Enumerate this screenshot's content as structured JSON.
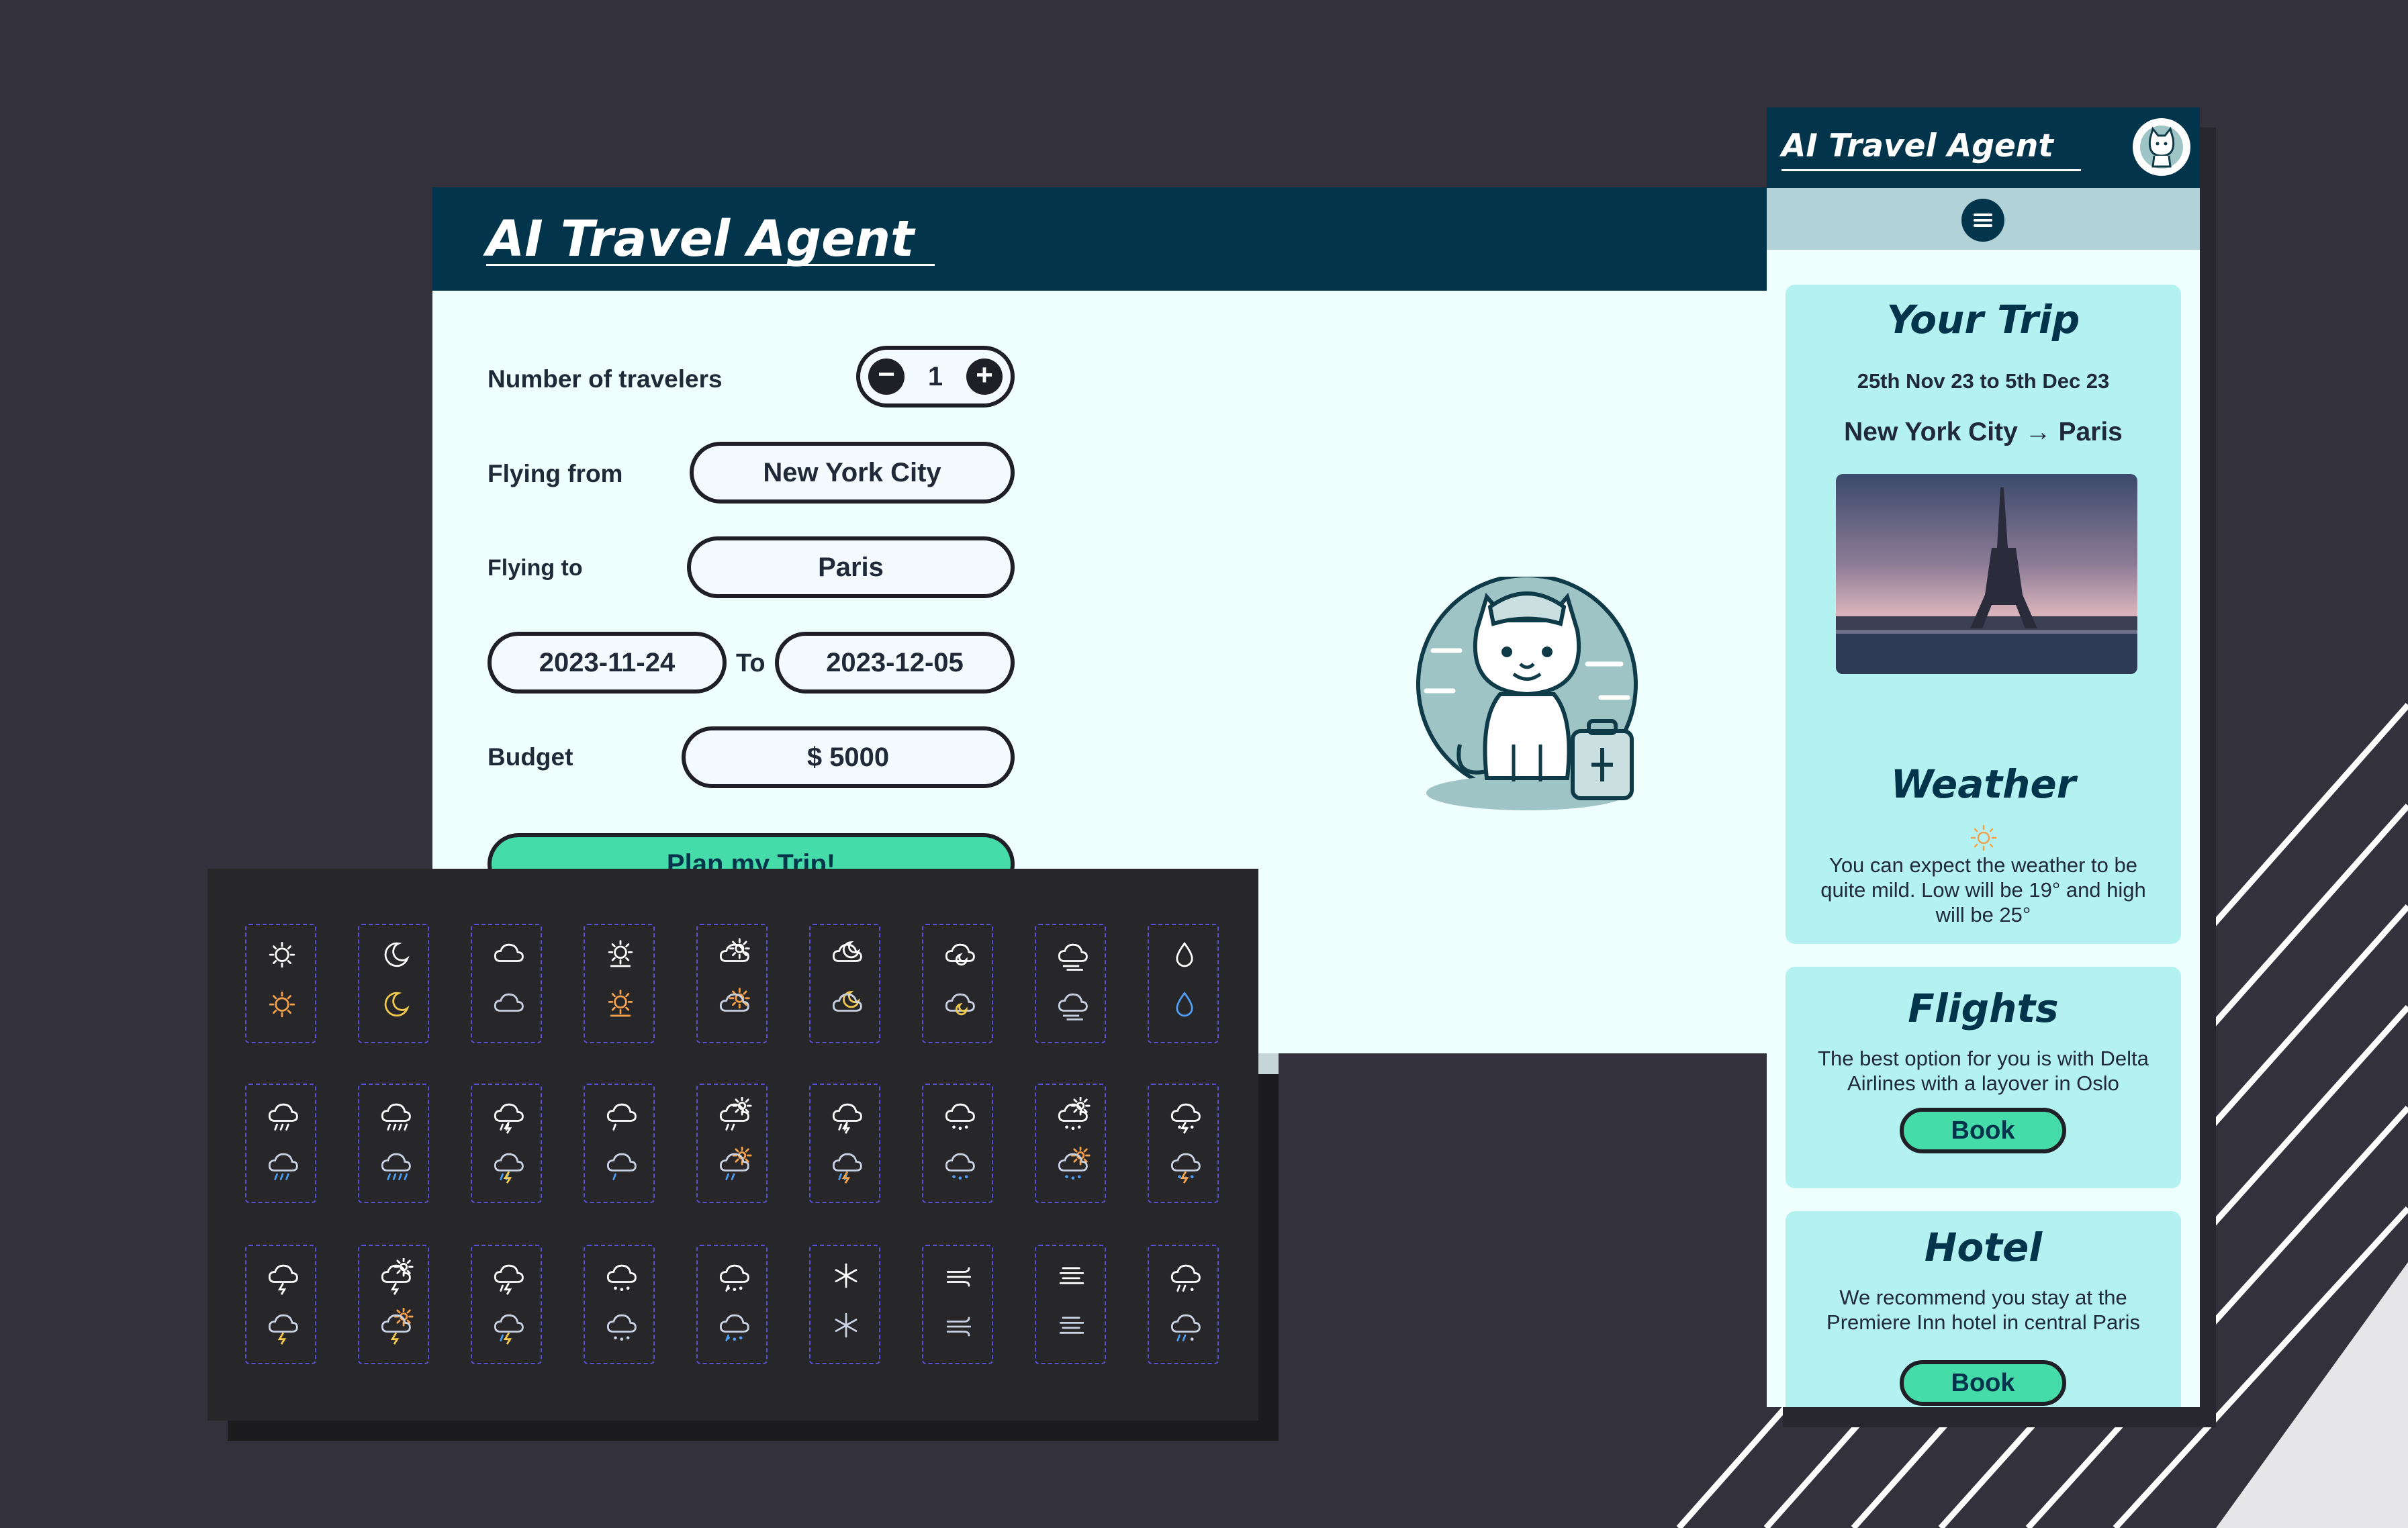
{
  "colors": {
    "background": "#33313b",
    "header": "#02344b",
    "panel": "#effffe",
    "card": "#b4f1f1",
    "accent": "#46dca9",
    "icon_dark_bg": "#27272a",
    "icon_border": "#5b4fd4"
  },
  "desktop": {
    "title": "AI Travel Agent",
    "travelers": {
      "label": "Number of travelers",
      "value": "1",
      "minus_icon": "minus-icon",
      "plus_icon": "plus-icon"
    },
    "from": {
      "label": "Flying from",
      "value": "New York City"
    },
    "to": {
      "label": "Flying to",
      "value": "Paris"
    },
    "dates": {
      "start": "2023-11-24",
      "separator": "To",
      "end": "2023-12-05"
    },
    "budget": {
      "label": "Budget",
      "value": "$ 5000"
    },
    "plan_button": "Plan my Trip!",
    "mascot_icon": "cat-pilot-mascot"
  },
  "mobile": {
    "title": "AI Travel Agent",
    "menu_icon": "hamburger-menu-icon",
    "trip": {
      "title": "Your Trip",
      "dates": "25th Nov 23 to 5th Dec 23",
      "route": "New York City → Paris",
      "image": "eiffel-tower-photo"
    },
    "weather": {
      "title": "Weather",
      "icon": "sun-icon",
      "text": "You can expect the weather to be quite mild. Low will be 19° and high will be 25°"
    },
    "flights": {
      "title": "Flights",
      "text": "The best option for you is with Delta Airlines with a layover in Oslo",
      "button": "Book"
    },
    "hotel": {
      "title": "Hotel",
      "text": "We recommend you stay at the Premiere Inn hotel in central Paris",
      "button": "Book"
    }
  },
  "icon_grid": {
    "rows": [
      [
        "sun-icon",
        "moon-icon",
        "cloud-icon",
        "sun-haze-icon",
        "partly-cloudy-day-icon",
        "partly-cloudy-night-icon",
        "cloud-night-icon",
        "fog-icon",
        "raindrop-icon"
      ],
      [
        "rain-icon",
        "heavy-rain-icon",
        "thunder-rain-icon",
        "drizzle-icon",
        "rain-day-icon",
        "rain-night-icon",
        "showers-icon",
        "showers-day-icon",
        "showers-night-icon"
      ],
      [
        "thunder-icon",
        "thunder-day-icon",
        "thunder-drizzle-icon",
        "sleet-icon",
        "hail-icon",
        "snowflake-icon",
        "wind-icon",
        "windy-fog-icon",
        "snow-rain-icon"
      ]
    ]
  }
}
